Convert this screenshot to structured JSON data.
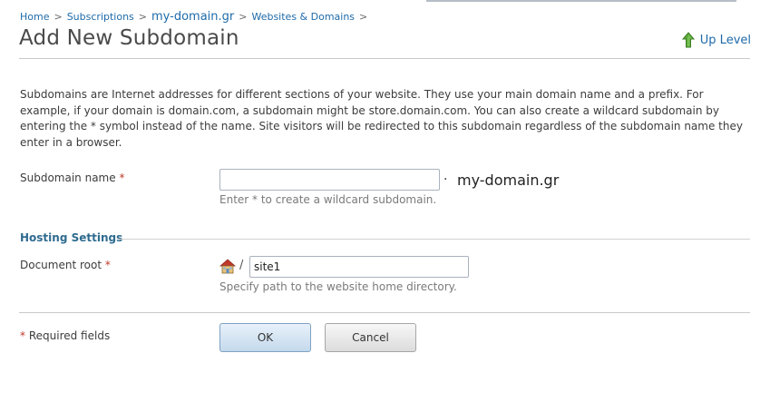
{
  "breadcrumb": {
    "home": "Home",
    "subscriptions": "Subscriptions",
    "domain": "my-domain.gr",
    "websites": "Websites & Domains",
    "separator": ">"
  },
  "header": {
    "title": "Add New Subdomain",
    "up_level": "Up Level"
  },
  "description": "Subdomains are Internet addresses for different sections of your website. They use your main domain name and a prefix. For example, if your domain is domain.com, a subdomain might be store.domain.com. You can also create a wildcard subdomain by entering the * symbol instead of the name. Site visitors will be redirected to this subdomain regardless of the subdomain name they enter in a browser.",
  "subdomain": {
    "label": "Subdomain name",
    "required_mark": "*",
    "value": "",
    "separator": "·",
    "suffix": "my-domain.gr",
    "hint": "Enter * to create a wildcard subdomain."
  },
  "hosting": {
    "section_title": "Hosting Settings",
    "doc_root_label": "Document root",
    "required_mark": "*",
    "path_separator": "/",
    "doc_root_value": "site1",
    "hint": "Specify path to the website home directory."
  },
  "footer": {
    "required_mark": "*",
    "required_text": "Required fields",
    "ok_label": "OK",
    "cancel_label": "Cancel"
  },
  "icons": {
    "up_level": "green-up-arrow-icon",
    "home": "home-icon"
  }
}
